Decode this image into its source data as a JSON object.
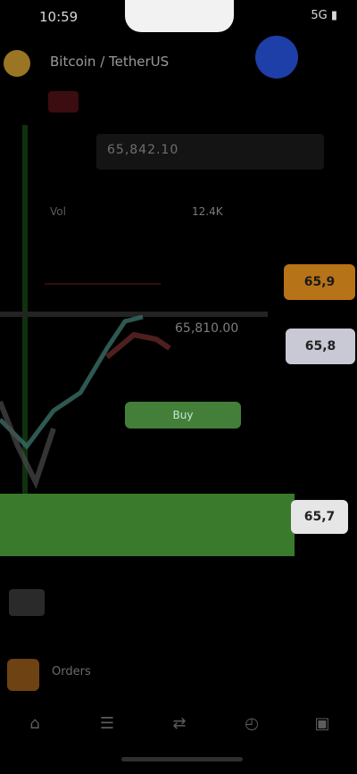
{
  "status_bar": {
    "time": "10:59",
    "right": "5G ▮"
  },
  "header": {
    "asset_title": "Bitcoin / TetherUS"
  },
  "chart": {
    "price_box": "65,842.10",
    "mid_label": "Vol",
    "mid_value": "12.4K",
    "overlay_label": "65,810.00",
    "green_pill": "Buy",
    "tags": {
      "orange": "65,9",
      "grey": "65,8",
      "white": "65,7"
    }
  },
  "orders": {
    "label": "Orders"
  },
  "tabs": [
    {
      "icon": "⌂",
      "name": "home"
    },
    {
      "icon": "☰",
      "name": "markets"
    },
    {
      "icon": "⇄",
      "name": "trade"
    },
    {
      "icon": "◴",
      "name": "futures"
    },
    {
      "icon": "▣",
      "name": "wallet"
    }
  ],
  "colors": {
    "green": "#3a7a2c",
    "orange": "#b77318",
    "blue": "#1e3ea8",
    "red": "#7a1b22"
  }
}
